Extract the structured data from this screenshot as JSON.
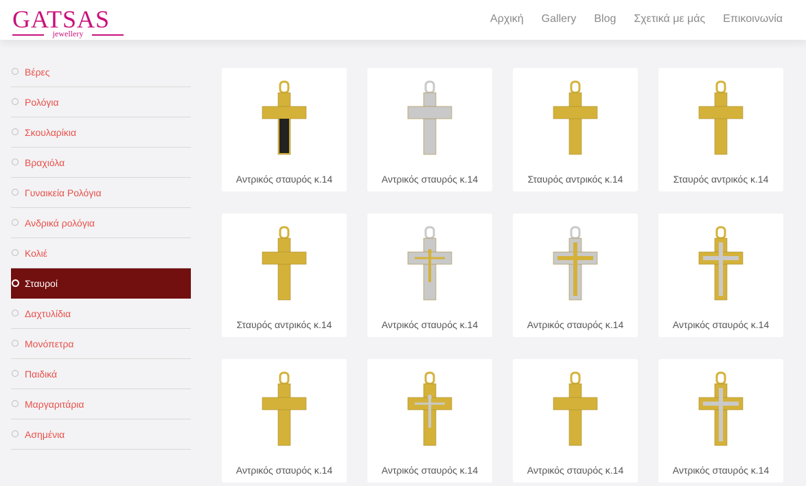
{
  "brand": {
    "name": "GATSAS",
    "tagline": "jewellery",
    "color": "#c8107a"
  },
  "nav": [
    "Αρχική",
    "Gallery",
    "Blog",
    "Σχετικά με μάς",
    "Επικοινωνία"
  ],
  "categories": [
    "Βέρες",
    "Ρολόγια",
    "Σκουλαρίκια",
    "Βραχιόλα",
    "Γυναικεία Ρολόγια",
    "Ανδρικά ρολόγια",
    "Κολιέ",
    "Σταυροί",
    "Δαχτυλίδια",
    "Μονόπετρα",
    "Παιδικά",
    "Μαργαριτάρια",
    "Ασημένια"
  ],
  "active_category": "Σταυροί",
  "products": [
    {
      "title": "Αντρικός σταυρός κ.14",
      "metal": "gold",
      "icon": "black-gold-cross"
    },
    {
      "title": "Αντρικός σταυρός κ.14",
      "metal": "white",
      "icon": "white-gold-cross"
    },
    {
      "title": "Σταυρός αντρικός κ.14",
      "metal": "gold",
      "icon": "gold-cross"
    },
    {
      "title": "Σταυρός αντρικός κ.14",
      "metal": "gold",
      "icon": "gold-cross"
    },
    {
      "title": "Σταυρός αντρικός κ.14",
      "metal": "gold",
      "icon": "gold-cross"
    },
    {
      "title": "Αντρικός σταυρός κ.14",
      "metal": "white",
      "icon": "crucifix"
    },
    {
      "title": "Αντρικός σταυρός κ.14",
      "metal": "white",
      "icon": "two-tone-cross"
    },
    {
      "title": "Αντρικός σταυρός κ.14",
      "metal": "gold",
      "icon": "two-tone-cross"
    },
    {
      "title": "Αντρικός σταυρός κ.14",
      "metal": "gold",
      "icon": "gold-cross"
    },
    {
      "title": "Αντρικός σταυρός κ.14",
      "metal": "gold",
      "icon": "crucifix"
    },
    {
      "title": "Αντρικός σταυρός κ.14",
      "metal": "gold",
      "icon": "gold-cross"
    },
    {
      "title": "Αντρικός σταυρός κ.14",
      "metal": "gold",
      "icon": "two-tone-cross"
    }
  ],
  "colors": {
    "accent": "#720f0f",
    "category_text": "#e8504a",
    "gold": "#d4b23a",
    "white_gold": "#c9c9c9"
  }
}
